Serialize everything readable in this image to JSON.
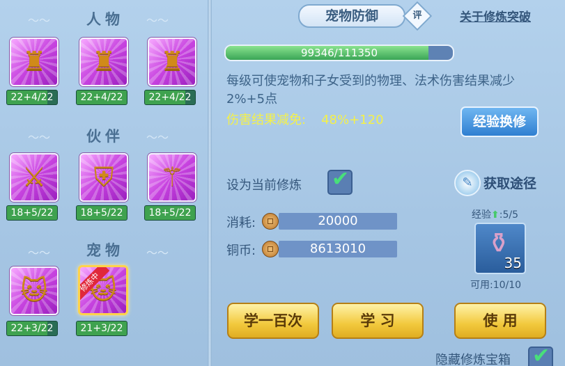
{
  "left": {
    "sections": [
      {
        "title": "人物",
        "items": [
          {
            "icon": "golden-warrior-glow-icon",
            "level": "22+4/22",
            "progress": 0.8
          },
          {
            "icon": "golden-armor-icon",
            "level": "22+4/22",
            "progress": 1.0
          },
          {
            "icon": "golden-warrior-icon",
            "level": "22+4/22",
            "progress": 0.8
          }
        ]
      },
      {
        "title": "伙伴",
        "items": [
          {
            "icon": "tiger-sword-icon",
            "level": "18+5/22",
            "progress": 1.0
          },
          {
            "icon": "tiger-shield-icon",
            "level": "18+5/22",
            "progress": 1.0
          },
          {
            "icon": "tiger-staff-icon",
            "level": "18+5/22",
            "progress": 1.0
          }
        ]
      },
      {
        "title": "宠物",
        "items": [
          {
            "icon": "cat-sword-icon",
            "level": "22+3/22",
            "progress": 0.8
          },
          {
            "icon": "cat-shield-icon",
            "level": "21+3/22",
            "progress": 1.0,
            "ribbon": "修炼中",
            "selected": true
          }
        ]
      }
    ]
  },
  "detail": {
    "title": "宠物防御",
    "rate_badge": "评",
    "about_link": "关于修炼突破",
    "exp": {
      "text": "99346/111350",
      "current": 99346,
      "max": 111350
    },
    "description": "每级可使宠物和子女受到的物理、法术伤害结果减少2%+5点",
    "reduce_label": "伤害结果减免:",
    "reduce_value": "48%+120",
    "exchange_button": "经验换修",
    "set_current_label": "设为当前修炼",
    "set_current_checked": true,
    "obtain_label": "获取途径",
    "cost_label": "消耗:",
    "cost_value": "20000",
    "copper_label": "铜币:",
    "copper_value": "8613010",
    "exp_item_label": "经验",
    "exp_item_value": ":5/5",
    "item_count": "35",
    "usable_text": "可用:10/10",
    "buttons": {
      "learn100": "学一百次",
      "learn": "学 习",
      "use": "使 用"
    },
    "hide_box_label": "隐藏修炼宝箱",
    "hide_box_checked": true
  },
  "colors": {
    "accent_blue": "#2f7fd1",
    "gold_button": "#f2c93d",
    "exp_green": "#3aa556",
    "reduce_text": "#f4f04a"
  }
}
